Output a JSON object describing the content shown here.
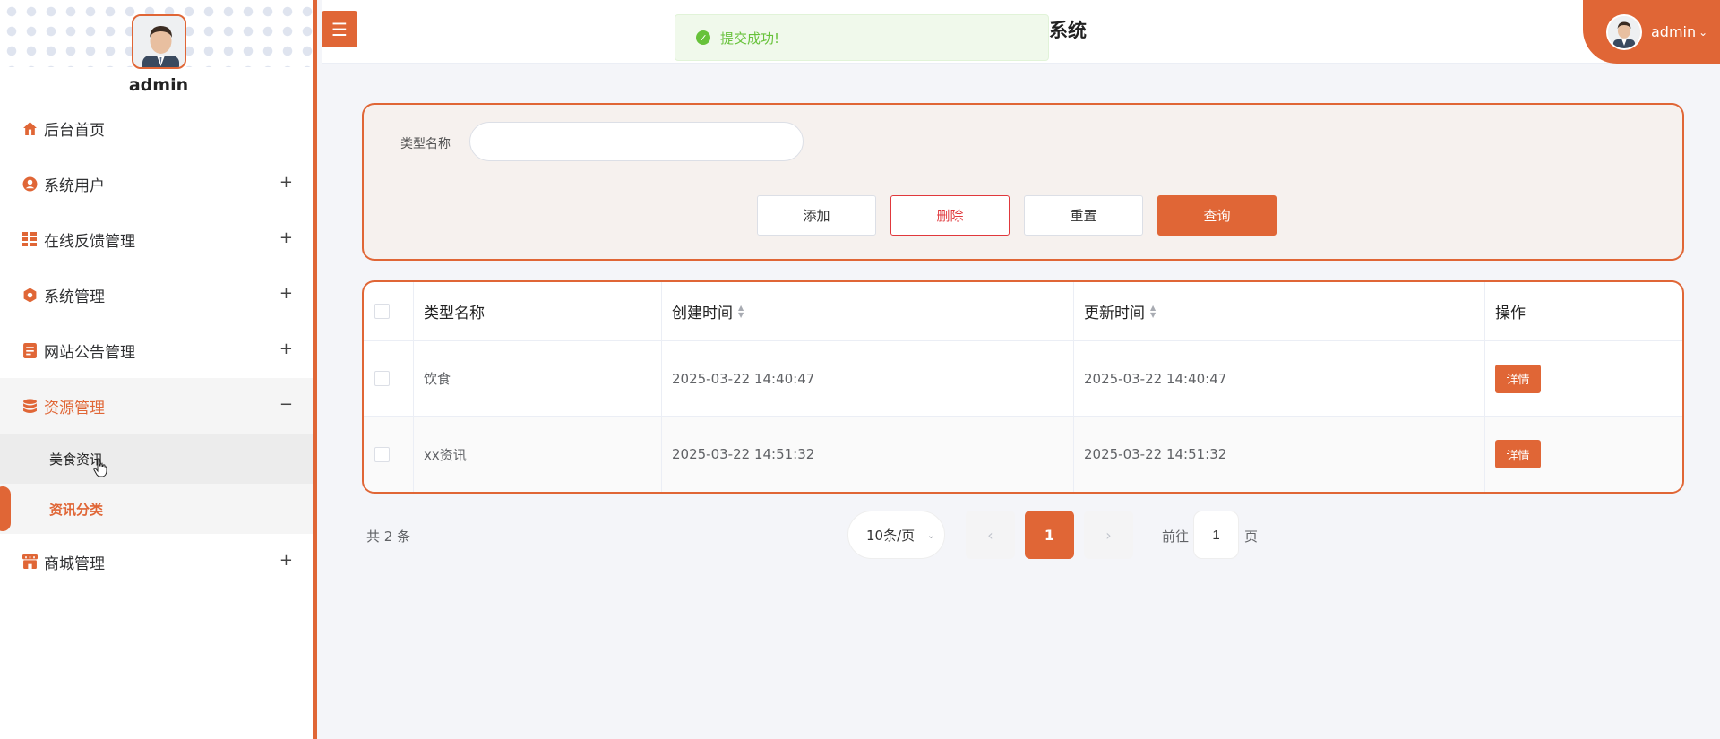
{
  "sidebar": {
    "username": "admin",
    "menu": [
      {
        "label": "后台首页"
      },
      {
        "label": "系统用户"
      },
      {
        "label": "在线反馈管理"
      },
      {
        "label": "系统管理"
      },
      {
        "label": "网站公告管理"
      },
      {
        "label": "资源管理"
      },
      {
        "label": "商城管理"
      }
    ],
    "submenu": [
      {
        "label": "美食资讯"
      },
      {
        "label": "资讯分类"
      }
    ],
    "expand_symbol": "+",
    "collapse_symbol": "−"
  },
  "header": {
    "menu_toggle": "☰",
    "title": "系统",
    "user": "admin"
  },
  "toast": {
    "message": "提交成功!"
  },
  "search": {
    "label": "类型名称",
    "value": "",
    "buttons": {
      "add": "添加",
      "delete": "删除",
      "reset": "重置",
      "query": "查询"
    }
  },
  "table": {
    "columns": [
      "类型名称",
      "创建时间",
      "更新时间",
      "操作"
    ],
    "rows": [
      {
        "name": "饮食",
        "created": "2025-03-22 14:40:47",
        "updated": "2025-03-22 14:40:47",
        "action": "详情"
      },
      {
        "name": "xx资讯",
        "created": "2025-03-22 14:51:32",
        "updated": "2025-03-22 14:51:32",
        "action": "详情"
      }
    ]
  },
  "pagination": {
    "total_text": "共 2 条",
    "page_size": "10条/页",
    "current_page": "1",
    "goto_prefix": "前往",
    "goto_value": "1",
    "goto_suffix": "页"
  },
  "colors": {
    "accent": "#e06636",
    "danger": "#e0383c",
    "success": "#67c23a"
  }
}
